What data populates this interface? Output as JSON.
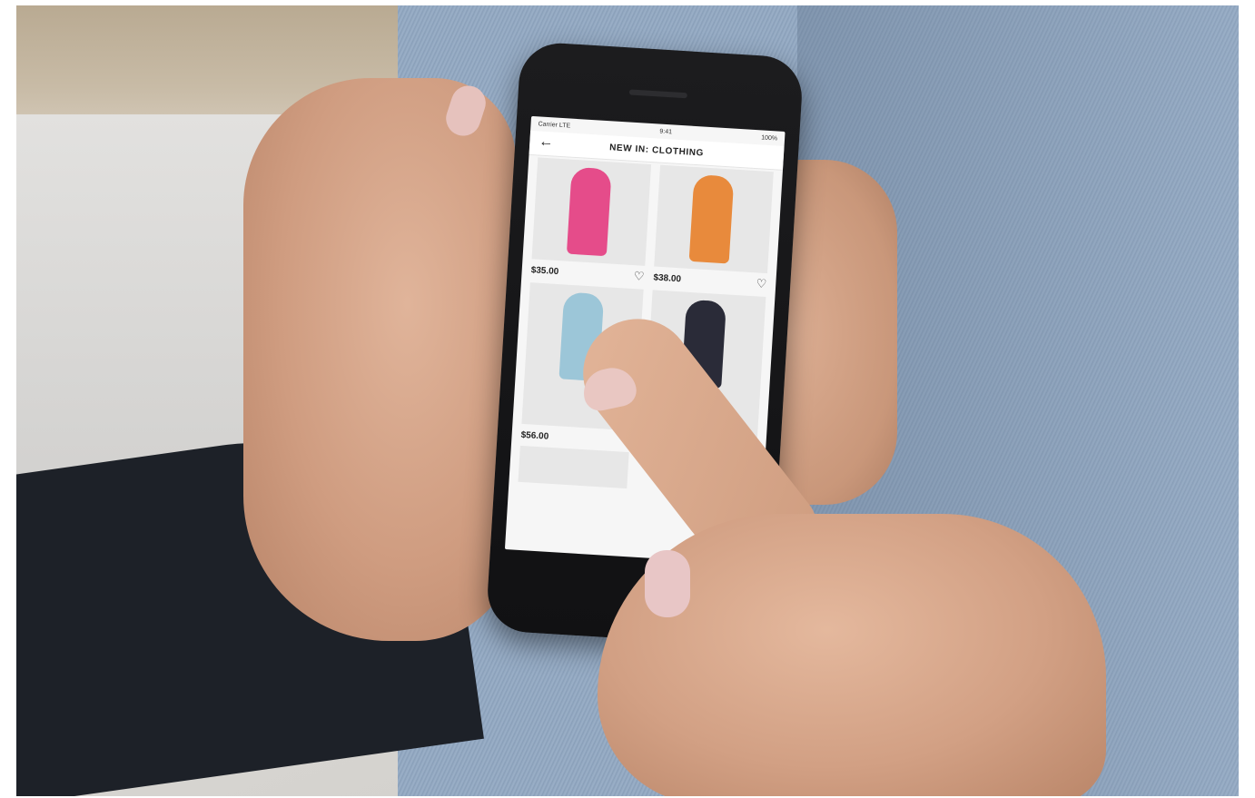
{
  "screen": {
    "status": {
      "carrier": "Carrier LTE",
      "time": "9:41",
      "battery": "100%"
    },
    "header": {
      "back_icon": "arrow-left-icon",
      "title": "NEW IN: CLOTHING"
    },
    "products": [
      {
        "price": "$35.00",
        "description": "",
        "icon": "heart-icon",
        "image_color": "#e54c8a"
      },
      {
        "price": "$38.00",
        "description": "",
        "icon": "heart-icon",
        "image_color": "#e88a3c"
      },
      {
        "price": "$56.00",
        "description": "",
        "icon": "heart-icon",
        "image_color": "#9cc6d8"
      },
      {
        "price": "",
        "description": "",
        "icon": "heart-icon",
        "image_color": "#2a2b38"
      }
    ]
  }
}
